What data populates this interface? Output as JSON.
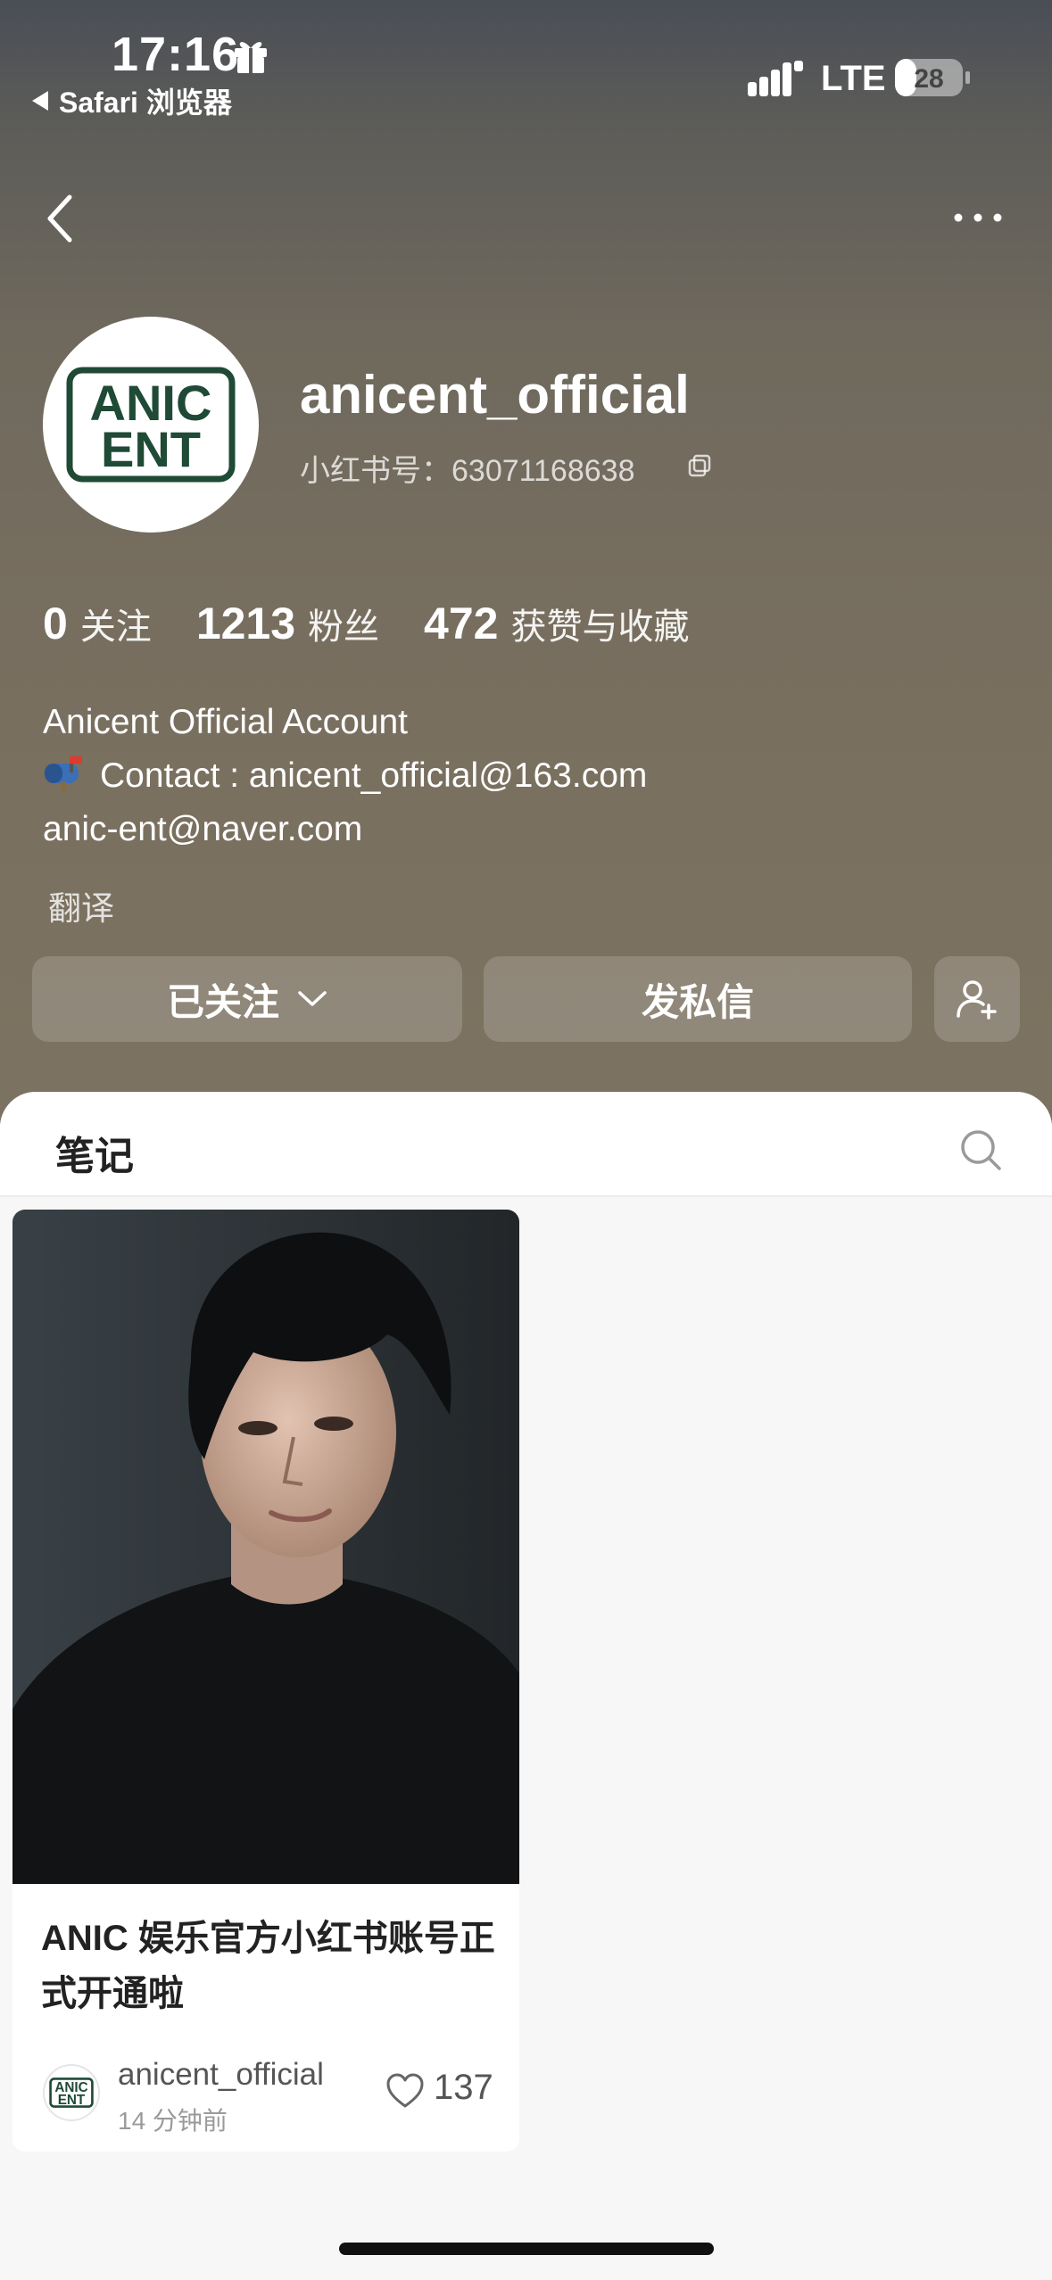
{
  "status_bar": {
    "time": "17:16",
    "back_app": "Safari 浏览器",
    "network": "LTE",
    "battery": "28"
  },
  "profile": {
    "username": "anicent_official",
    "red_id": "小红书号：63071168638",
    "avatar_text_top": "ANIC",
    "avatar_text_bottom": "ENT",
    "stats": [
      {
        "value": "0",
        "label": "关注"
      },
      {
        "value": "1213",
        "label": "粉丝"
      },
      {
        "value": "472",
        "label": "获赞与收藏"
      }
    ],
    "bio": [
      "Anicent Official Account",
      "Contact : anicent_official@163.com",
      "anic-ent@naver.com"
    ],
    "translate": "翻译"
  },
  "actions": {
    "follow_label": "已关注",
    "message_label": "发私信"
  },
  "notes_tab": {
    "label": "笔记"
  },
  "note_card": {
    "title": "ANIC 娱乐官方小红书账号正式开通啦",
    "author": "anicent_official",
    "time": "14 分钟前",
    "likes": "137"
  },
  "colors": {
    "header_top": "#4a4e55",
    "header_bottom": "#7c7261",
    "logo_green": "#1f4a36"
  }
}
